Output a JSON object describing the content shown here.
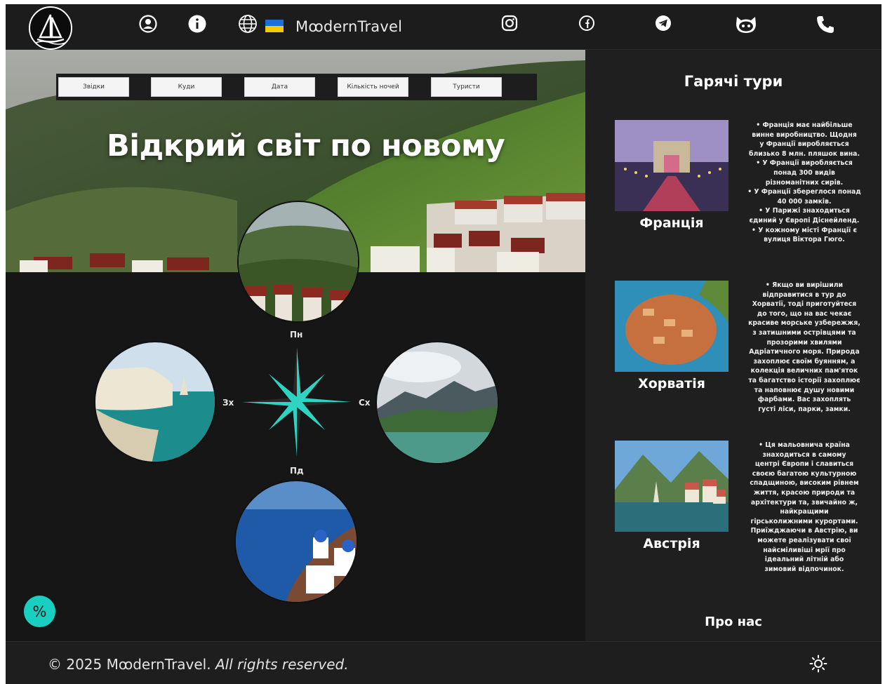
{
  "header": {
    "brand": "MꚙdernTravel",
    "icons": [
      "user-icon",
      "info-icon",
      "globe-icon",
      "instagram-icon",
      "facebook-icon",
      "telegram-icon",
      "github-icon",
      "phone-icon"
    ],
    "flag_colors": [
      "#1d6fd6",
      "#f5c800"
    ]
  },
  "search": {
    "from": "Звідки",
    "to": "Куди",
    "date": "Дата",
    "nights": "Кількість ночей",
    "tourists": "Туристи"
  },
  "hero": {
    "title": "Відкрий світ по новому"
  },
  "compass": {
    "north": "Пн",
    "south": "Пд",
    "west": "Зх",
    "east": "Сх",
    "accent": "#2fd3c2"
  },
  "discount_label": "%",
  "hot_tours": {
    "title": "Гарячі тури",
    "tours": [
      {
        "name": "Франція",
        "lines": [
          "• Франція має найбільше",
          "винне виробництво. Щодня",
          "у Франції виробляється",
          "близько 8 млн. пляшок вина.",
          "• У Франції виробляється",
          "понад 300 видів",
          "різноманітних сирів.",
          "• У Франції збереглося понад",
          "40 000 замків.",
          "• У Парижі знаходиться",
          "єдиний у Європі Діснейленд.",
          "• У кожному місті Франції є",
          "вулиця Віктора Гюго."
        ]
      },
      {
        "name": "Хорватія",
        "lines": [
          "• Якщо ви вирішили",
          "відправитися в тур до",
          "Хорватії, тоді приготуйтеся",
          "до того, що на вас чекає",
          "красиве морське узбережжя,",
          "з затишними острівцями та",
          "прозорими хвилями",
          "Адріатичного моря. Природа",
          "захоплює своїм буянням, а",
          "колекція величних пам'яток",
          "та багатство історії захоплює",
          "та наповнює душу новими",
          "фарбами. Вас захоплять",
          "густі ліси, парки, замки."
        ]
      },
      {
        "name": "Австрія",
        "lines": [
          "• Ця мальовнича країна",
          "знаходиться в самому",
          "центрі Європи і славиться",
          "своєю багатою культурною",
          "спадщиною, високим рівнем",
          "життя, красою природи та",
          "архітектури та, звичайно ж,",
          "найкращими",
          "гірськолижними курортами.",
          "Приїжджаючи в Австрію, ви",
          "можете реалізувати свої",
          "найсміливіші мрії про",
          "ідеальний літній або",
          "зимовий відпочинок."
        ]
      }
    ],
    "about": "Про нас"
  },
  "footer": {
    "copyright": "© 2025 MꚙdernTravel.",
    "rights": "All rights reserved."
  }
}
